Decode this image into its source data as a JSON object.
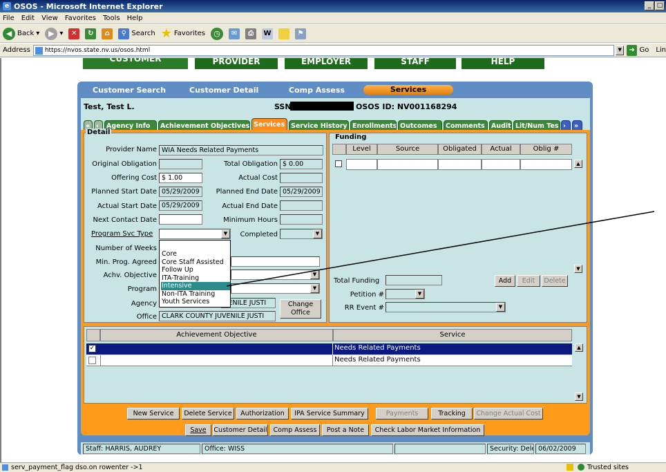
{
  "window": {
    "title": "OSOS - Microsoft Internet Explorer"
  },
  "menu": [
    "File",
    "Edit",
    "View",
    "Favorites",
    "Tools",
    "Help"
  ],
  "toolbar": {
    "back": "Back",
    "search": "Search",
    "favorites": "Favorites"
  },
  "address": {
    "label": "Address",
    "url": "https://nvos.state.nv.us/osos.html",
    "go": "Go",
    "links": "Lin"
  },
  "topnav": {
    "customer": "CUSTOMER",
    "provider": "PROVIDER",
    "employer": "EMPLOYER",
    "staff": "STAFF",
    "help": "HELP"
  },
  "subnav": {
    "customer_search": "Customer Search",
    "customer_detail": "Customer Detail",
    "comp_assess": "Comp Assess",
    "services": "Services"
  },
  "customer": {
    "name": "Test, Test L.",
    "ssn_label": "SSN",
    "osos_id": "OSOS ID: NV001168294"
  },
  "tabs": [
    "Agency Info",
    "Achievement Objectives",
    "Services",
    "Service History",
    "Enrollments",
    "Outcomes",
    "Comments",
    "Audit",
    "Lit/Num Tes"
  ],
  "detail": {
    "legend": "Detail",
    "provider_name_label": "Provider Name",
    "provider_name": "WIA Needs Related Payments",
    "original_obligation_label": "Original Obligation",
    "original_obligation": "",
    "total_obligation_label": "Total Obligation",
    "total_obligation": "$ 0.00",
    "offering_cost_label": "Offering Cost",
    "offering_cost": "$ 1.00",
    "actual_cost_label": "Actual Cost",
    "actual_cost": "",
    "planned_start_label": "Planned Start Date",
    "planned_start": "05/29/2009",
    "planned_end_label": "Planned End Date",
    "planned_end": "05/29/2009",
    "actual_start_label": "Actual Start Date",
    "actual_start": "05/29/2009",
    "actual_end_label": "Actual End Date",
    "actual_end": "",
    "next_contact_label": "Next Contact Date",
    "next_contact": "",
    "min_hours_label": "Minimum Hours",
    "min_hours": "",
    "program_svc_type_label": "Program Svc Type",
    "completed_label": "Completed",
    "weeks_label": "Number of Weeks",
    "min_prog_label": "Min. Prog. Agreed",
    "achv_obj_label": "Achv. Objective",
    "program_label": "Program",
    "agency_label": "Agency",
    "agency": "VENILE JUSTI",
    "office_label": "Office",
    "office": "CLARK COUNTY JUVENILE JUSTI",
    "change_office": "Change Office"
  },
  "dropdown": {
    "options": [
      "Core",
      "Core Staff Assisted",
      "Follow Up",
      "ITA-Training",
      "Intensive",
      "Non-ITA Training",
      "Youth Services"
    ],
    "selected": "Intensive"
  },
  "funding": {
    "legend": "Funding",
    "columns": [
      "Level",
      "Source",
      "Obligated",
      "Actual",
      "Oblig #"
    ],
    "total_label": "Total Funding",
    "petition_label": "Petition #",
    "rr_event_label": "RR Event #",
    "add": "Add",
    "edit": "Edit",
    "delete": "Delete"
  },
  "achievement": {
    "columns": [
      "Achievement Objective",
      "Service"
    ],
    "rows": [
      {
        "objective": "",
        "service": "Needs Related Payments",
        "checked": true
      },
      {
        "objective": "",
        "service": "Needs Related Payments",
        "checked": false
      }
    ]
  },
  "actions": [
    "New Service",
    "Delete Service",
    "Authorization",
    "IPA Service Summary",
    "Payments",
    "Tracking",
    "Change Actual Cost"
  ],
  "bottom_actions": [
    "Save",
    "Customer Detail",
    "Comp Assess",
    "Post a Note",
    "Check Labor Market Information"
  ],
  "footer": {
    "staff": "Staff: HARRIS, AUDREY",
    "office": "Office: WISS",
    "security": "Security: Delete",
    "date": "06/02/2009"
  },
  "status": {
    "text": "serv_payment_flag dso.on rowenter ->1",
    "zone": "Trusted sites"
  }
}
